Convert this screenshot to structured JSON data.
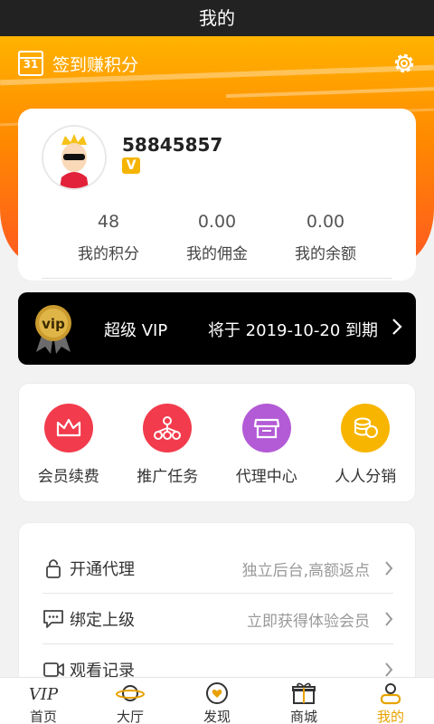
{
  "titlebar": {
    "title": "我的"
  },
  "signin": {
    "calendar_day": "31",
    "label": "签到赚积分"
  },
  "profile": {
    "user_id": "58845857",
    "badge": "V",
    "stats": [
      {
        "value": "48",
        "label": "我的积分"
      },
      {
        "value": "0.00",
        "label": "我的佣金"
      },
      {
        "value": "0.00",
        "label": "我的余额"
      }
    ]
  },
  "vip": {
    "medal_text": "vip",
    "title": "超级 VIP",
    "expiry": "将于 2019-10-20 到期"
  },
  "actions": [
    {
      "label": "会员续费",
      "icon": "crown-icon",
      "color": "#f23b4c"
    },
    {
      "label": "推广任务",
      "icon": "network-icon",
      "color": "#f23b4c"
    },
    {
      "label": "代理中心",
      "icon": "store-icon",
      "color": "#b35ad6"
    },
    {
      "label": "人人分销",
      "icon": "coins-icon",
      "color": "#f7b500"
    }
  ],
  "menu": [
    {
      "title": "开通代理",
      "right": "独立后台,高额返点",
      "icon": "lock-icon"
    },
    {
      "title": "绑定上级",
      "right": "立即获得体验会员",
      "icon": "chat-icon"
    },
    {
      "title": "观看记录",
      "right": "",
      "icon": "video-icon"
    }
  ],
  "tabbar": [
    {
      "label": "首页",
      "icon": "vip-home-icon"
    },
    {
      "label": "大厅",
      "icon": "planet-icon"
    },
    {
      "label": "发现",
      "icon": "heart-icon"
    },
    {
      "label": "商城",
      "icon": "gift-icon"
    },
    {
      "label": "我的",
      "icon": "user-icon",
      "active": true
    }
  ],
  "colors": {
    "accent": "#e8a200",
    "hero_top": "#ffb300",
    "hero_bottom": "#ff5a1f"
  }
}
